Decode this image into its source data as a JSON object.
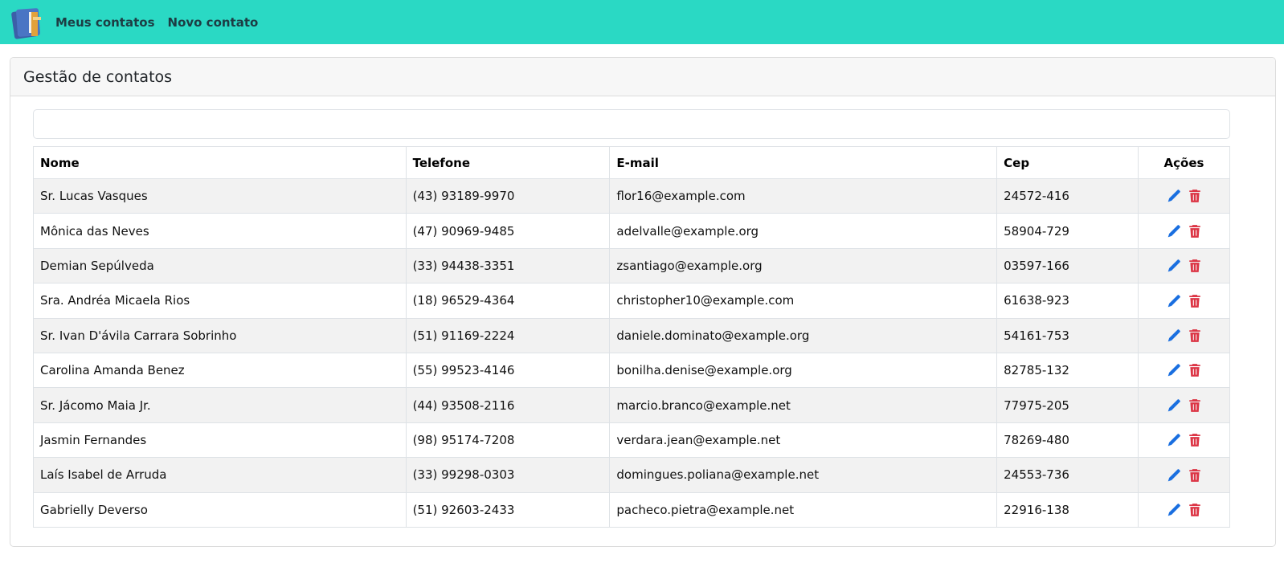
{
  "navbar": {
    "logo_icon": "address-book-logo-icon",
    "links": [
      "Meus contatos",
      "Novo contato"
    ],
    "background": "#2ad9c4"
  },
  "card": {
    "title": "Gestão de contatos",
    "search": {
      "value": "",
      "placeholder": ""
    }
  },
  "table": {
    "headers": [
      "Nome",
      "Telefone",
      "E-mail",
      "Cep",
      "Ações"
    ],
    "rows": [
      {
        "name": "Sr. Lucas Vasques",
        "phone": "(43) 93189-9970",
        "email": "flor16@example.com",
        "cep": "24572-416"
      },
      {
        "name": "Mônica das Neves",
        "phone": "(47) 90969-9485",
        "email": "adelvalle@example.org",
        "cep": "58904-729"
      },
      {
        "name": "Demian Sepúlveda",
        "phone": "(33) 94438-3351",
        "email": "zsantiago@example.org",
        "cep": "03597-166"
      },
      {
        "name": "Sra. Andréa Micaela Rios",
        "phone": "(18) 96529-4364",
        "email": "christopher10@example.com",
        "cep": "61638-923"
      },
      {
        "name": "Sr. Ivan D'ávila Carrara Sobrinho",
        "phone": "(51) 91169-2224",
        "email": "daniele.dominato@example.org",
        "cep": "54161-753"
      },
      {
        "name": "Carolina Amanda Benez",
        "phone": "(55) 99523-4146",
        "email": "bonilha.denise@example.org",
        "cep": "82785-132"
      },
      {
        "name": "Sr. Jácomo Maia Jr.",
        "phone": "(44) 93508-2116",
        "email": "marcio.branco@example.net",
        "cep": "77975-205"
      },
      {
        "name": "Jasmin Fernandes",
        "phone": "(98) 95174-7208",
        "email": "verdara.jean@example.net",
        "cep": "78269-480"
      },
      {
        "name": "Laís Isabel de Arruda",
        "phone": "(33) 99298-0303",
        "email": "domingues.poliana@example.net",
        "cep": "24553-736"
      },
      {
        "name": "Gabrielly Deverso",
        "phone": "(51) 92603-2433",
        "email": "pacheco.pietra@example.net",
        "cep": "22916-138"
      }
    ],
    "actions": {
      "edit_icon": "pencil-icon",
      "delete_icon": "trash-icon",
      "edit_color": "#1a6fe0",
      "delete_color": "#dc3545"
    }
  }
}
